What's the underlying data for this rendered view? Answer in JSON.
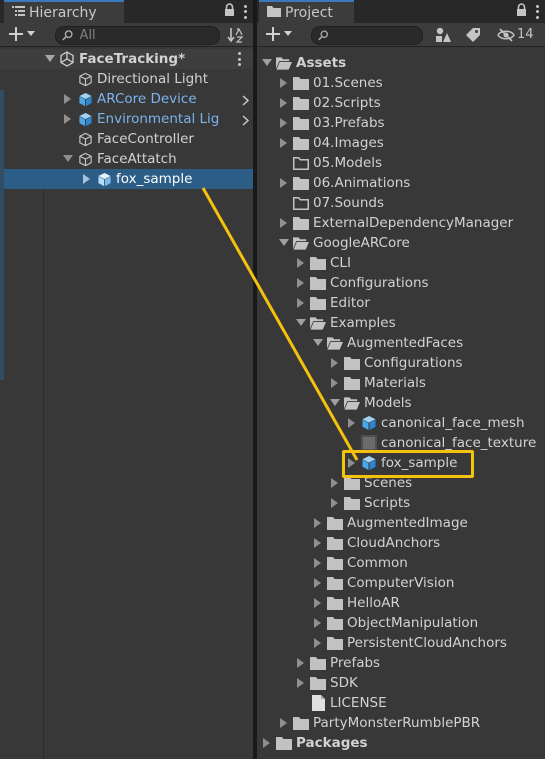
{
  "hierarchy": {
    "tab_label": "Hierarchy",
    "search_placeholder": "All",
    "scene": "FaceTracking*",
    "items": [
      {
        "label": "Directional Light"
      },
      {
        "label": "ARCore Device"
      },
      {
        "label": "Environmental Lig"
      },
      {
        "label": "FaceController"
      },
      {
        "label": "FaceAttatch"
      },
      {
        "label": "fox_sample"
      }
    ]
  },
  "project": {
    "tab_label": "Project",
    "visible_count": "14",
    "items": [
      {
        "label": "Assets"
      },
      {
        "label": "01.Scenes"
      },
      {
        "label": "02.Scripts"
      },
      {
        "label": "03.Prefabs"
      },
      {
        "label": "04.Images"
      },
      {
        "label": "05.Models"
      },
      {
        "label": "06.Animations"
      },
      {
        "label": "07.Sounds"
      },
      {
        "label": "ExternalDependencyManager"
      },
      {
        "label": "GoogleARCore"
      },
      {
        "label": "CLI"
      },
      {
        "label": "Configurations"
      },
      {
        "label": "Editor"
      },
      {
        "label": "Examples"
      },
      {
        "label": "AugmentedFaces"
      },
      {
        "label": "Configurations"
      },
      {
        "label": "Materials"
      },
      {
        "label": "Models"
      },
      {
        "label": "canonical_face_mesh"
      },
      {
        "label": "canonical_face_texture"
      },
      {
        "label": "fox_sample"
      },
      {
        "label": "Scenes"
      },
      {
        "label": "Scripts"
      },
      {
        "label": "AugmentedImage"
      },
      {
        "label": "CloudAnchors"
      },
      {
        "label": "Common"
      },
      {
        "label": "ComputerVision"
      },
      {
        "label": "HelloAR"
      },
      {
        "label": "ObjectManipulation"
      },
      {
        "label": "PersistentCloudAnchors"
      },
      {
        "label": "Prefabs"
      },
      {
        "label": "SDK"
      },
      {
        "label": "LICENSE"
      },
      {
        "label": "PartyMonsterRumblePBR"
      },
      {
        "label": "Packages"
      }
    ]
  },
  "colors": {
    "selection": "#2c5d87",
    "prefab_text": "#7bb3ec",
    "callout": "#f4c20d"
  }
}
